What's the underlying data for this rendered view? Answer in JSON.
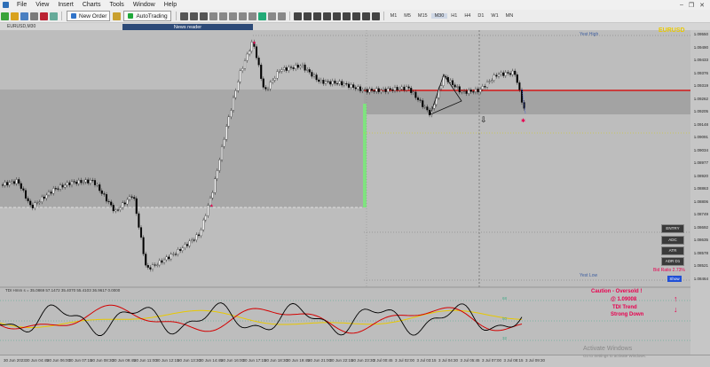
{
  "menu": [
    "File",
    "View",
    "Insert",
    "Charts",
    "Tools",
    "Window",
    "Help"
  ],
  "toolbar": {
    "new_order": "New Order",
    "auto_trading": "AutoTrading",
    "timeframes": [
      "M1",
      "M5",
      "M15",
      "M30",
      "H1",
      "H4",
      "D1",
      "W1",
      "MN"
    ],
    "selected_tf": "M30"
  },
  "chart_tab": "EURUSD,M30",
  "news_reader": "News reader",
  "symbol": "EURUSD",
  "labels": {
    "yest_high": "Yest High",
    "yest_low": "Yest Low",
    "bid_ratio": "Bid Ratio 2.73%",
    "show": "Show"
  },
  "side_buttons": [
    "ENTRY",
    "ADC",
    "ATR",
    "ADR D1"
  ],
  "indicator_header": "TDI Hmm s = 35.0869 57.1472 35.4070 55.4103 36.9617 0.0000",
  "indicator_levels": [
    "68",
    "50",
    "32"
  ],
  "caution": {
    "line1": "Caution - Oversold !",
    "line2": "@ 1.09008",
    "line3": "TDI Trend",
    "line4": "Strong Down"
  },
  "price_axis": [
    "1.09550",
    "1.09490",
    "1.09433",
    "1.09376",
    "1.09319",
    "1.09262",
    "1.09205",
    "1.09148",
    "1.09091",
    "1.09034",
    "1.08977",
    "1.08920",
    "1.08863",
    "1.08806",
    "1.08749",
    "1.08692",
    "1.08635",
    "1.08578",
    "1.08521",
    "1.08464"
  ],
  "time_axis": [
    "30 Jun 2023",
    "30 Jun 04:45",
    "30 Jun 06:00",
    "30 Jun 07:15",
    "30 Jun 08:30",
    "30 Jun 09:45",
    "30 Jun 11:00",
    "30 Jun 12:15",
    "30 Jun 13:30",
    "30 Jun 14:45",
    "30 Jun 16:00",
    "30 Jun 17:15",
    "30 Jun 18:30",
    "30 Jun 19:45",
    "30 Jun 21:00",
    "30 Jun 22:15",
    "30 Jun 23:30",
    "3 Jul 00:45",
    "3 Jul 02:00",
    "3 Jul 03:15",
    "3 Jul 04:30",
    "3 Jul 05:45",
    "3 Jul 07:00",
    "3 Jul 08:15",
    "3 Jul 09:30"
  ],
  "watermark": {
    "line1": "Activate Windows",
    "line2": "Go to Settings to activate Windows."
  },
  "colors": {
    "bull": "#ffffff",
    "bear": "#000000",
    "resistance": "#e00000",
    "yellow": "#e8c800",
    "green_bar": "#7fe37f",
    "pink": "#e8004f",
    "blue": "#1f4fd6"
  }
}
